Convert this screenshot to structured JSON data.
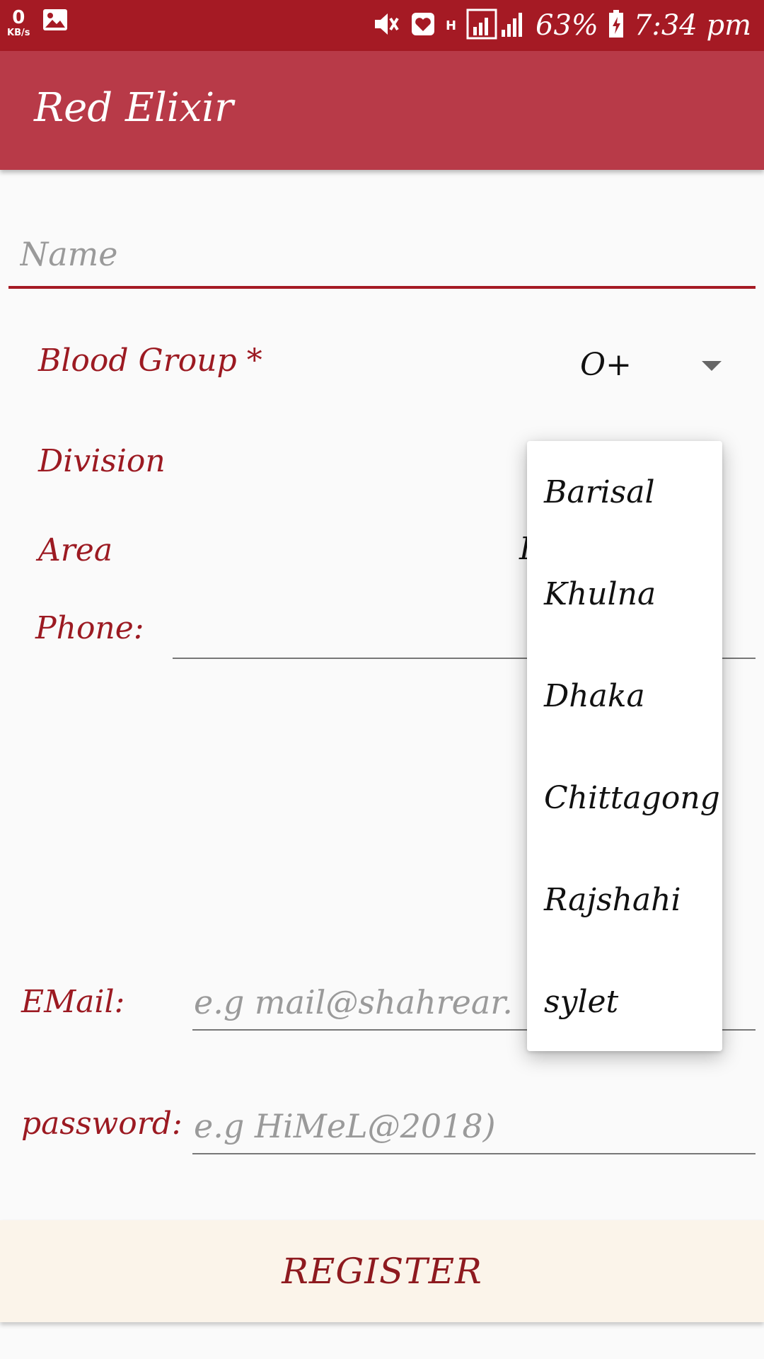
{
  "status_bar": {
    "network_speed": "0",
    "network_speed_unit": "KB/s",
    "network_type": "H",
    "battery": "63%",
    "time": "7:34 pm",
    "icons": [
      "image-icon",
      "mute-icon",
      "heart-app-icon",
      "signal-icon",
      "battery-charging-icon"
    ]
  },
  "app": {
    "title": "Red Elixir"
  },
  "form": {
    "name_placeholder": "Name",
    "blood_group_label": "Blood Group *",
    "blood_group_value": "O+",
    "division_label": "Division",
    "area_label": "Area",
    "area_value_partial": "I",
    "phone_label": "Phone:",
    "email_label": "EMail:",
    "email_placeholder": "e.g mail@shahrear.",
    "password_label": "password:",
    "password_placeholder": "e.g HiMeL@2018)",
    "register_label": "REGISTER"
  },
  "dropdown": {
    "options": [
      "Barisal",
      "Khulna",
      "Dhaka",
      "Chittagong",
      "Rajshahi",
      "sylet"
    ]
  },
  "colors": {
    "status_bar": "#a51a24",
    "app_bar": "#b83a48",
    "label": "#9c1a22",
    "register_bg": "#fbf4ea"
  }
}
